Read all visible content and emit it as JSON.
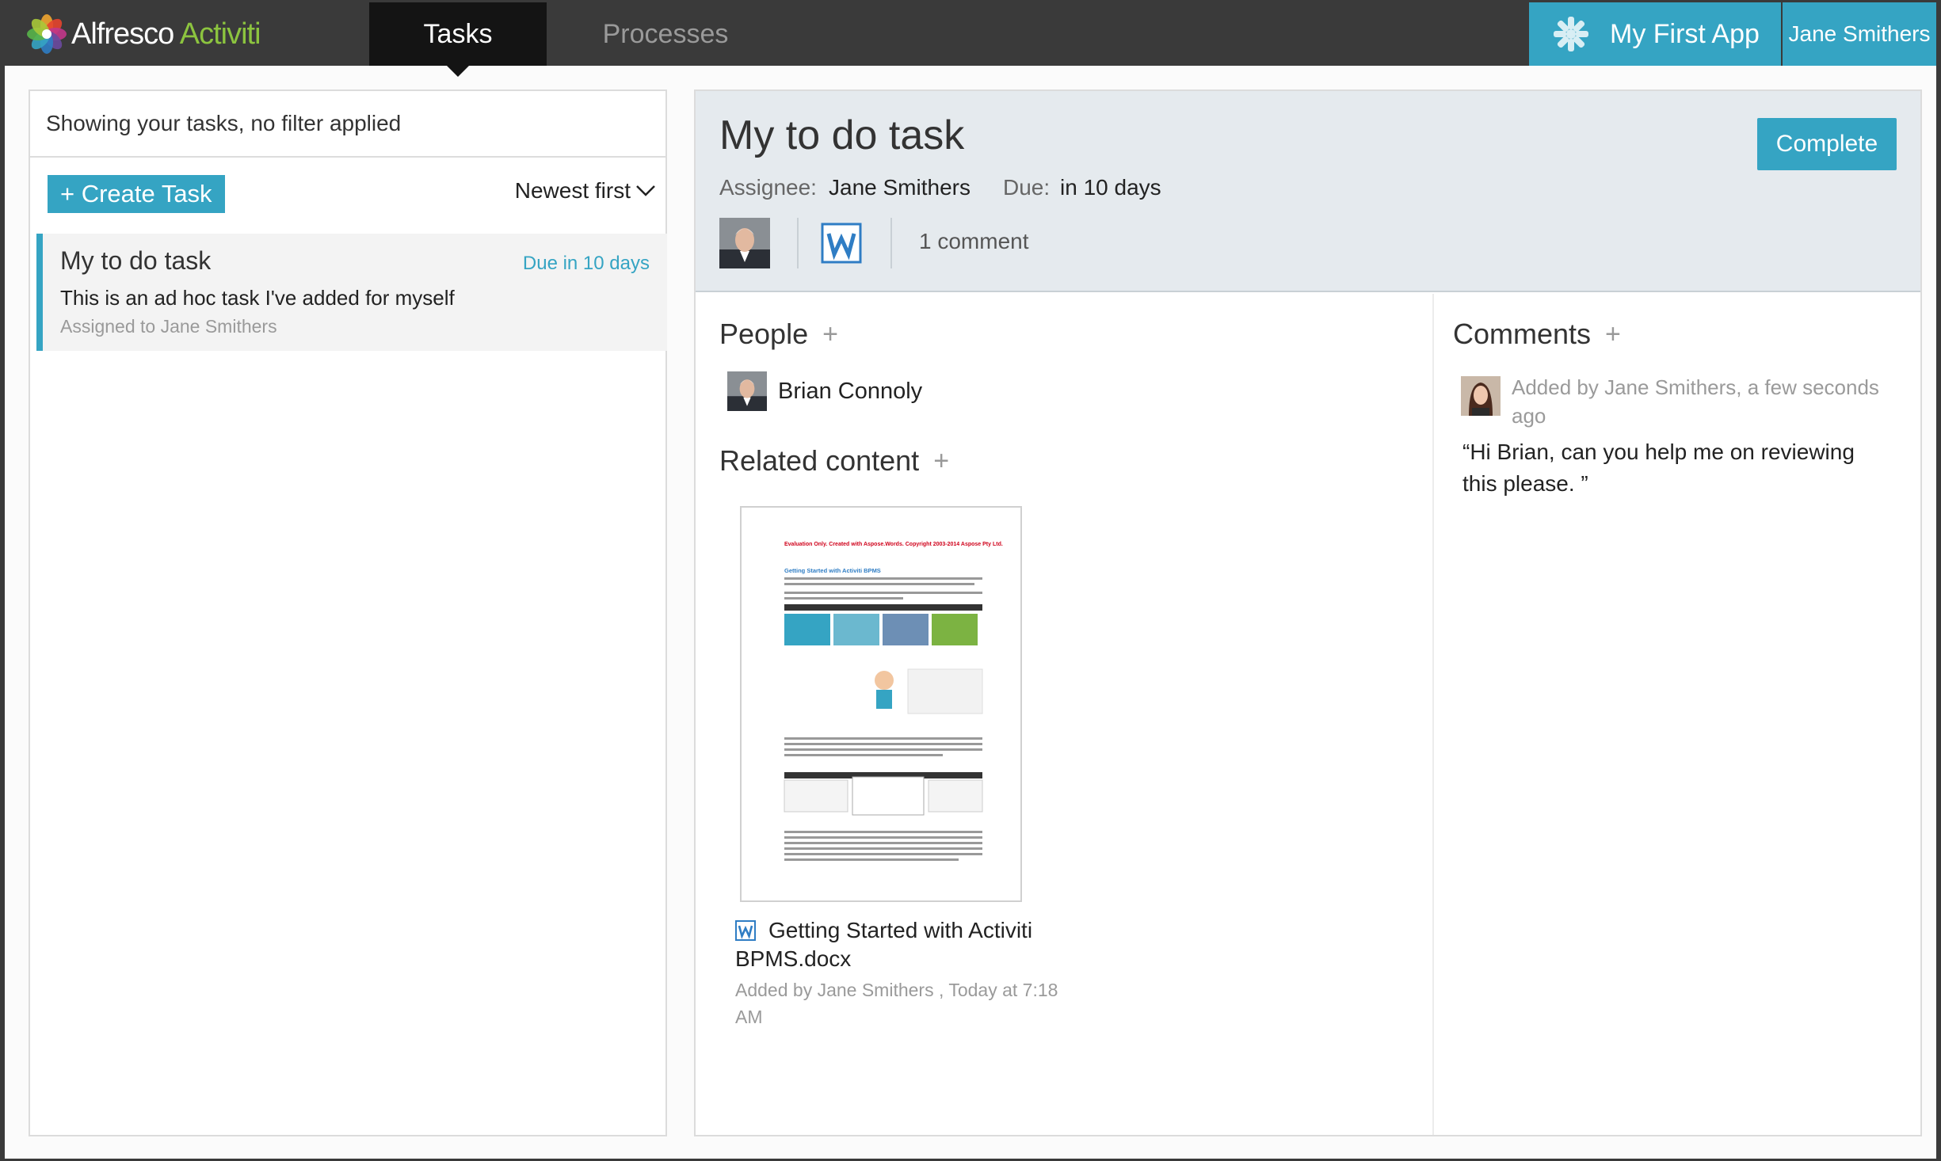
{
  "nav": {
    "logo_main": "Alfresco",
    "logo_accent": "Activiti",
    "tabs": [
      {
        "label": "Tasks",
        "active": true
      },
      {
        "label": "Processes",
        "active": false
      }
    ],
    "app_name": "My First App",
    "user_name": "Jane Smithers"
  },
  "task_list": {
    "filter_text": "Showing your tasks, no filter applied",
    "create_button": "+ Create Task",
    "sort_label": "Newest first",
    "tasks": [
      {
        "title": "My to do task",
        "due": "Due in 10 days",
        "description": "This is an ad hoc task I've added for myself",
        "assigned": "Assigned to Jane Smithers"
      }
    ]
  },
  "task_detail": {
    "title": "My to do task",
    "complete_button": "Complete",
    "assignee_label": "Assignee:",
    "assignee_value": "Jane Smithers",
    "due_label": "Due:",
    "due_value": "in 10 days",
    "comment_count": "1 comment",
    "people": {
      "title": "People",
      "add": "+",
      "items": [
        {
          "name": "Brian Connoly"
        }
      ]
    },
    "related_content": {
      "title": "Related content",
      "add": "+",
      "file_name_line1": "Getting Started with Activiti",
      "file_name_line2": "BPMS.docx",
      "added_by": "Added by Jane Smithers , Today at 7:18 AM",
      "doc_heading": "Evaluation Only. Created with Aspose.Words. Copyright 2003-2014 Aspose Pty Ltd.",
      "doc_section": "Getting Started with Activiti BPMS"
    },
    "comments": {
      "title": "Comments",
      "add": "+",
      "items": [
        {
          "meta": "Added by Jane Smithers, a few seconds ago",
          "text": "“Hi Brian, can you help me on reviewing this please. ”"
        }
      ]
    }
  },
  "colors": {
    "accent": "#35a4c3",
    "topbar": "#3a3a3a",
    "active_tab": "#141414",
    "logo_green": "#8cc43f",
    "header_bg": "#e5eaee"
  }
}
